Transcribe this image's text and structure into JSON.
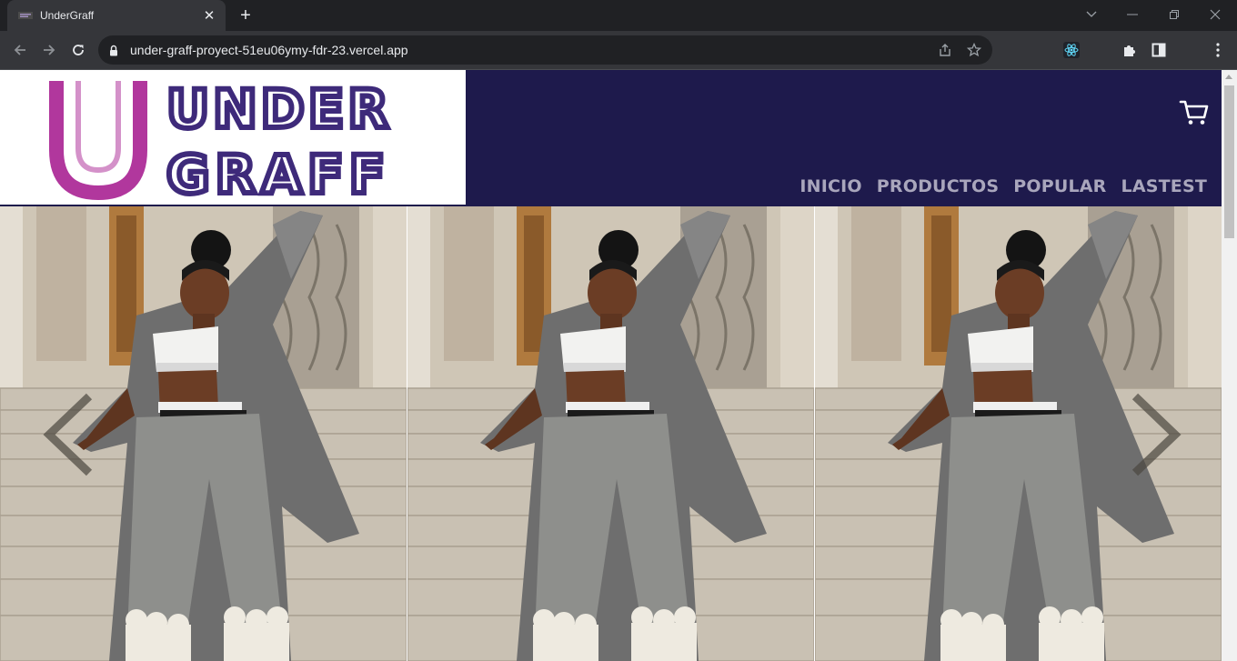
{
  "browser": {
    "tab": {
      "title": "UnderGraff"
    },
    "address": {
      "url": "under-graff-proyect-51eu06ymy-fdr-23.vercel.app"
    }
  },
  "site": {
    "logo": {
      "line1": "UNDER",
      "line2": "GRAFF",
      "letter": "U"
    },
    "nav": [
      {
        "label": "INICIO"
      },
      {
        "label": "PRODUCTOS"
      },
      {
        "label": "POPULAR"
      },
      {
        "label": "LASTEST"
      }
    ],
    "icons": {
      "cart": "cart-icon"
    }
  },
  "colors": {
    "header_bg": "#1e1a4c",
    "nav_text": "#a9a6bc",
    "logo_magenta": "#b1379d",
    "logo_purple": "#3e2a7a"
  }
}
